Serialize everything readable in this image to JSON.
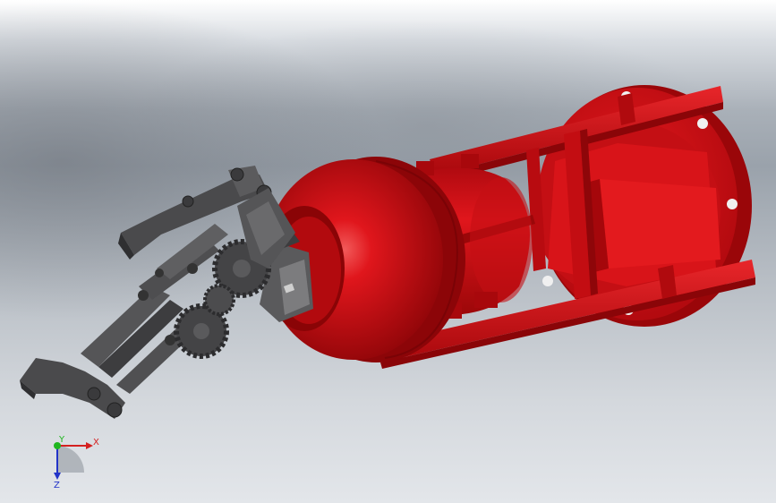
{
  "triad": {
    "x_label": "X",
    "y_label": "Y",
    "z_label": "Z",
    "colors": {
      "x": "#d42020",
      "y": "#1fb61f",
      "z": "#2233c8"
    }
  },
  "model": {
    "body_color": "#d01418",
    "gripper_color": "#4a4a4c"
  }
}
